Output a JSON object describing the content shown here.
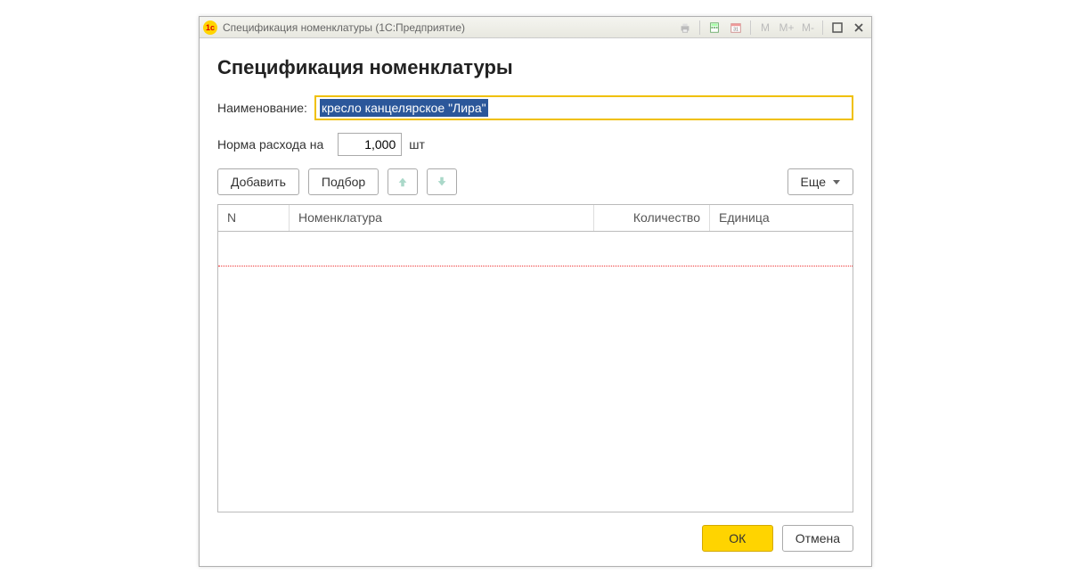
{
  "titlebar": {
    "title": "Спецификация номенклатуры  (1С:Предприятие)",
    "m_labels": [
      "M",
      "M+",
      "M-"
    ]
  },
  "page": {
    "heading": "Спецификация номенклатуры"
  },
  "form": {
    "name_label": "Наименование:",
    "name_value": "кресло канцелярское \"Лира\"",
    "rate_label": "Норма расхода на",
    "rate_value": "1,000",
    "rate_unit": "шт"
  },
  "toolbar": {
    "add": "Добавить",
    "pick": "Подбор",
    "more": "Еще"
  },
  "table": {
    "columns": {
      "n": "N",
      "item": "Номенклатура",
      "qty": "Количество",
      "unit": "Единица"
    }
  },
  "footer": {
    "ok": "ОК",
    "cancel": "Отмена"
  }
}
